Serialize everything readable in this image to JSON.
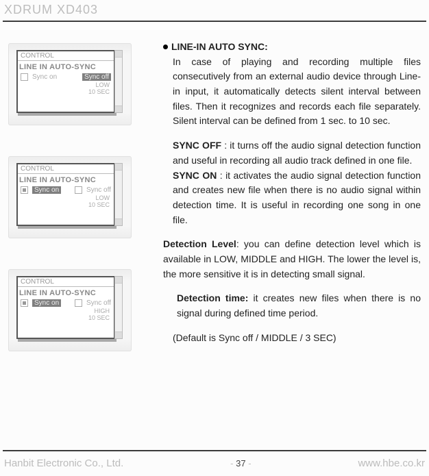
{
  "header": {
    "product_name": "XDRUM XD403"
  },
  "figures": [
    {
      "panel_title": "CONTROL",
      "main_label": "LINE IN AUTO-SYNC",
      "left_check": "off",
      "left_label": "Sync on",
      "right_highlight": "Sync off",
      "bottom_line1": "LOW",
      "bottom_line2": "10 SEC"
    },
    {
      "panel_title": "CONTROL",
      "main_label": "LINE IN AUTO-SYNC",
      "left_check": "on",
      "left_highlight": "Sync on",
      "right_label": "Sync off",
      "bottom_line1": "LOW",
      "bottom_line2": "10 SEC"
    },
    {
      "panel_title": "CONTROL",
      "main_label": "LINE IN AUTO-SYNC",
      "left_check": "on",
      "left_highlight": "Sync on",
      "right_label": "Sync off",
      "bottom_line1": "HIGH",
      "bottom_line2": "10 SEC"
    }
  ],
  "body": {
    "title": "LINE-IN AUTO SYNC:",
    "lead": "In case of playing and recording multiple files consecutively from an external audio device through Line-in input, it automatically detects silent interval between files. Then it   recognizes and records each file separately. Silent interval can be defined from 1 sec. to 10 sec.",
    "sync_off_label": "SYNC OFF",
    "sync_off_text": " : it turns off the audio signal detection function and useful in recording all audio track defined in one file.",
    "sync_on_label": "SYNC ON",
    "sync_on_text": " : it activates the audio signal detection function and creates new file when there is no audio signal within detection time. It is useful in recording one song in one file.",
    "detect_level_label": "Detection Level",
    "detect_level_text": ": you can define detection level which is available in LOW, MIDDLE and HIGH. The lower the level is, the more sensitive it is in detecting small signal.",
    "detect_time_label": "Detection time:",
    "detect_time_text": " it creates new files when there is no signal during defined time period.",
    "default_line": "(Default is Sync off / MIDDLE / 3 SEC)"
  },
  "footer": {
    "company": "Hanbit Electronic Co., Ltd.",
    "page_prefix": "- ",
    "page_number": "37",
    "page_suffix": " -",
    "url": "www.hbe.co.kr"
  }
}
